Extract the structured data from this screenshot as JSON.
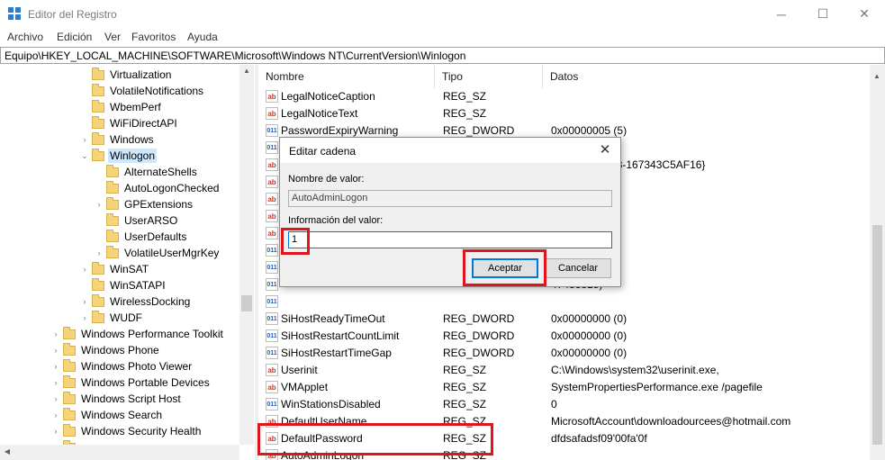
{
  "window": {
    "title": "Editor del Registro",
    "minimize_glyph": "─",
    "maximize_glyph": "☐",
    "close_glyph": "✕"
  },
  "menu": [
    "Archivo",
    "Edición",
    "Ver",
    "Favoritos",
    "Ayuda"
  ],
  "address": "Equipo\\HKEY_LOCAL_MACHINE\\SOFTWARE\\Microsoft\\Windows NT\\CurrentVersion\\Winlogon",
  "tree": [
    {
      "label": "Virtualization",
      "expander": "",
      "level": 1
    },
    {
      "label": "VolatileNotifications",
      "expander": "",
      "level": 1
    },
    {
      "label": "WbemPerf",
      "expander": "",
      "level": 1
    },
    {
      "label": "WiFiDirectAPI",
      "expander": "",
      "level": 1
    },
    {
      "label": "Windows",
      "expander": "›",
      "level": 1
    },
    {
      "label": "Winlogon",
      "expander": "⌄",
      "level": 1,
      "selected": true
    },
    {
      "label": "AlternateShells",
      "expander": "",
      "level": 2
    },
    {
      "label": "AutoLogonChecked",
      "expander": "",
      "level": 2
    },
    {
      "label": "GPExtensions",
      "expander": "›",
      "level": 2
    },
    {
      "label": "UserARSO",
      "expander": "",
      "level": 2
    },
    {
      "label": "UserDefaults",
      "expander": "",
      "level": 2
    },
    {
      "label": "VolatileUserMgrKey",
      "expander": "›",
      "level": 2
    },
    {
      "label": "WinSAT",
      "expander": "›",
      "level": 1
    },
    {
      "label": "WinSATAPI",
      "expander": "",
      "level": 1
    },
    {
      "label": "WirelessDocking",
      "expander": "›",
      "level": 1
    },
    {
      "label": "WUDF",
      "expander": "›",
      "level": 1
    },
    {
      "label": "Windows Performance Toolkit",
      "expander": "›",
      "level": 0
    },
    {
      "label": "Windows Phone",
      "expander": "›",
      "level": 0
    },
    {
      "label": "Windows Photo Viewer",
      "expander": "›",
      "level": 0
    },
    {
      "label": "Windows Portable Devices",
      "expander": "›",
      "level": 0
    },
    {
      "label": "Windows Script Host",
      "expander": "›",
      "level": 0
    },
    {
      "label": "Windows Search",
      "expander": "›",
      "level": 0
    },
    {
      "label": "Windows Security Health",
      "expander": "›",
      "level": 0
    },
    {
      "label": "",
      "expander": "",
      "level": 0
    }
  ],
  "columns": {
    "name": "Nombre",
    "type": "Tipo",
    "data": "Datos"
  },
  "values": [
    {
      "icon": "ab",
      "name": "LegalNoticeCaption",
      "type": "REG_SZ",
      "data": ""
    },
    {
      "icon": "ab",
      "name": "LegalNoticeText",
      "type": "REG_SZ",
      "data": ""
    },
    {
      "icon": "bin",
      "name": "PasswordExpiryWarning",
      "type": "REG_DWORD",
      "data": "0x00000005 (5)"
    },
    {
      "icon": "bin",
      "name": "",
      "type": "",
      "data": ""
    },
    {
      "icon": "ab",
      "name": "",
      "type": "",
      "data": "30-4FF6-BD18-167343C5AF16}"
    },
    {
      "icon": "ab",
      "name": "",
      "type": "",
      "data": ""
    },
    {
      "icon": "ab",
      "name": "",
      "type": "",
      "data": ""
    },
    {
      "icon": "ab",
      "name": "",
      "type": "",
      "data": ""
    },
    {
      "icon": "ab",
      "name": "",
      "type": "",
      "data": ""
    },
    {
      "icon": "bin",
      "name": "",
      "type": "",
      "data": ""
    },
    {
      "icon": "bin",
      "name": "",
      "type": "",
      "data": ""
    },
    {
      "icon": "bin",
      "name": "",
      "type": "",
      "data": "47483815)"
    },
    {
      "icon": "bin",
      "name": "",
      "type": "",
      "data": ""
    },
    {
      "icon": "bin",
      "name": "SiHostReadyTimeOut",
      "type": "REG_DWORD",
      "data": "0x00000000 (0)"
    },
    {
      "icon": "bin",
      "name": "SiHostRestartCountLimit",
      "type": "REG_DWORD",
      "data": "0x00000000 (0)"
    },
    {
      "icon": "bin",
      "name": "SiHostRestartTimeGap",
      "type": "REG_DWORD",
      "data": "0x00000000 (0)"
    },
    {
      "icon": "ab",
      "name": "Userinit",
      "type": "REG_SZ",
      "data": "C:\\Windows\\system32\\userinit.exe,"
    },
    {
      "icon": "ab",
      "name": "VMApplet",
      "type": "REG_SZ",
      "data": "SystemPropertiesPerformance.exe /pagefile"
    },
    {
      "icon": "bin",
      "name": "WinStationsDisabled",
      "type": "REG_SZ",
      "data": "0"
    },
    {
      "icon": "ab",
      "name": "DefaultUserName",
      "type": "REG_SZ",
      "data": "MicrosoftAccount\\downloadourcees@hotmail.com"
    },
    {
      "icon": "ab",
      "name": "DefaultPassword",
      "type": "REG_SZ",
      "data": "dfdsafadsf09'00fa'0f"
    },
    {
      "icon": "ab",
      "name": "AutoAdminLogon",
      "type": "REG_SZ",
      "data": ""
    }
  ],
  "dialog": {
    "title": "Editar cadena",
    "name_label": "Nombre de valor:",
    "name_value": "AutoAdminLogon",
    "data_label": "Información del valor:",
    "data_value": "1",
    "ok_label": "Aceptar",
    "cancel_label": "Cancelar"
  },
  "highlight_color": "#e0141c"
}
